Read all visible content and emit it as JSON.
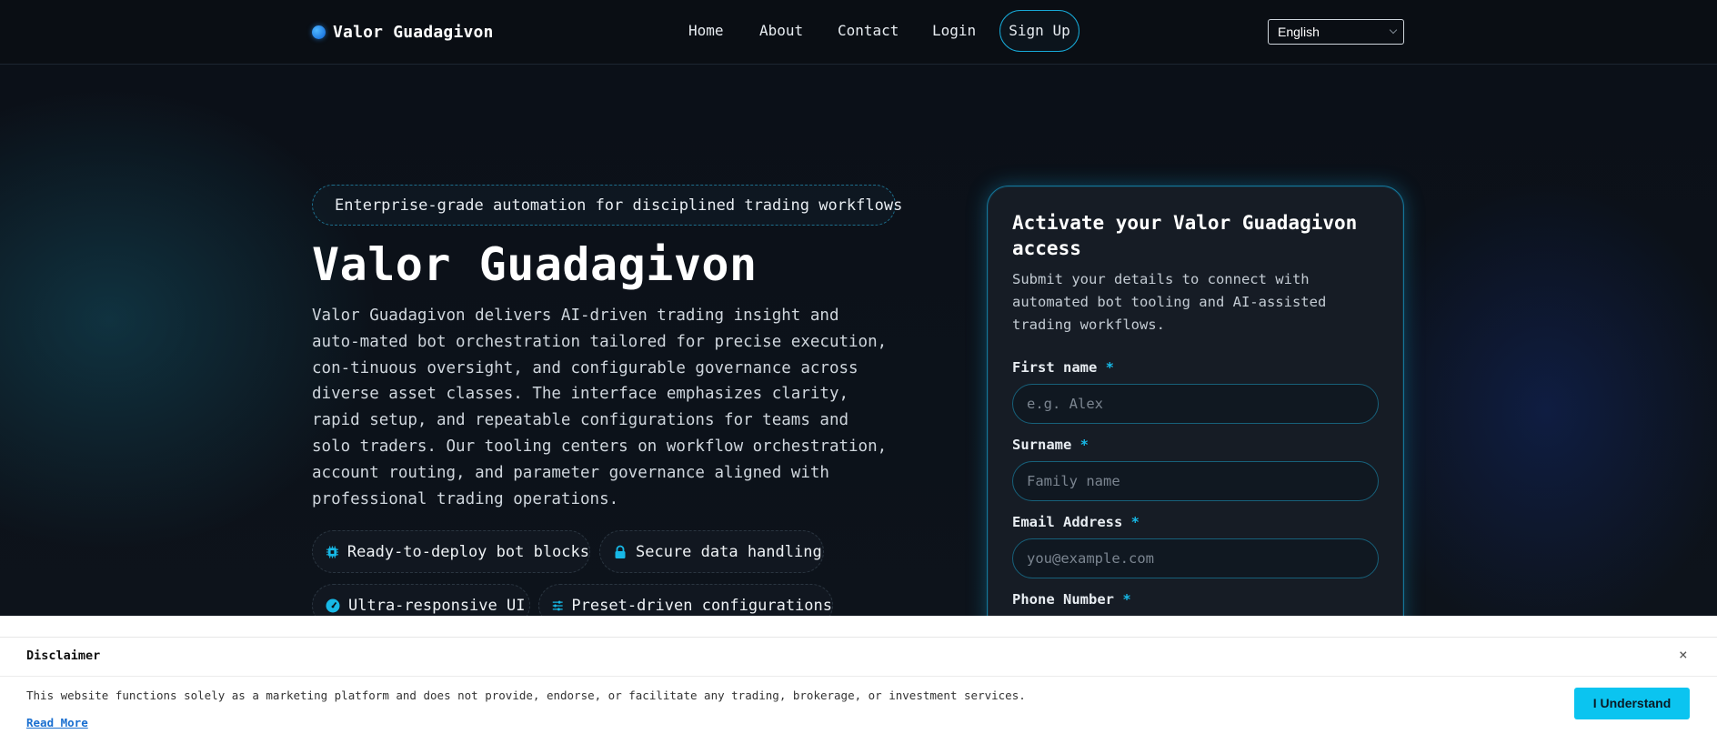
{
  "header": {
    "brand": "Valor Guadagivon",
    "nav": [
      {
        "label": "Home"
      },
      {
        "label": "About"
      },
      {
        "label": "Contact"
      },
      {
        "label": "Login"
      }
    ],
    "signup_label": "Sign Up",
    "language": "English"
  },
  "hero": {
    "badge": "Enterprise-grade automation for disciplined trading workflows",
    "title": "Valor Guadagivon",
    "description": "Valor Guadagivon delivers AI-driven trading insight and auto-mated bot orchestration tailored for precise execution, con-tinuous oversight, and configurable governance across diverse asset classes. The interface emphasizes clarity, rapid setup, and repeatable configurations for teams and solo traders. Our tooling centers on workflow orchestration, account routing, and parameter governance aligned with professional trading operations.",
    "features": [
      {
        "label": "Ready-to-deploy bot blocks",
        "icon": "chip-icon"
      },
      {
        "label": "Secure data handling",
        "icon": "lock-icon"
      },
      {
        "label": "Ultra-responsive UI",
        "icon": "gauge-icon"
      },
      {
        "label": "Preset-driven configurations",
        "icon": "sliders-icon"
      }
    ]
  },
  "form": {
    "title": "Activate your Valor Guadagivon access",
    "subtitle": "Submit your details to connect with automated bot tooling and AI-assisted trading workflows.",
    "fields": {
      "first_name": {
        "label": "First name",
        "placeholder": "e.g. Alex"
      },
      "surname": {
        "label": "Surname",
        "placeholder": "Family name"
      },
      "email": {
        "label": "Email Address",
        "placeholder": "you@example.com"
      },
      "phone": {
        "label": "Phone Number"
      }
    },
    "required_mark": "*"
  },
  "disclaimer": {
    "title": "Disclaimer",
    "close": "×",
    "text": "This website functions solely as a marketing platform and does not provide, endorse, or facilitate any trading, brokerage, or investment services.",
    "read_more": "Read More",
    "accept_label": "I Understand"
  },
  "colors": {
    "accent": "#17b8e6",
    "background": "#0b1017",
    "button": "#0bc4f0"
  }
}
